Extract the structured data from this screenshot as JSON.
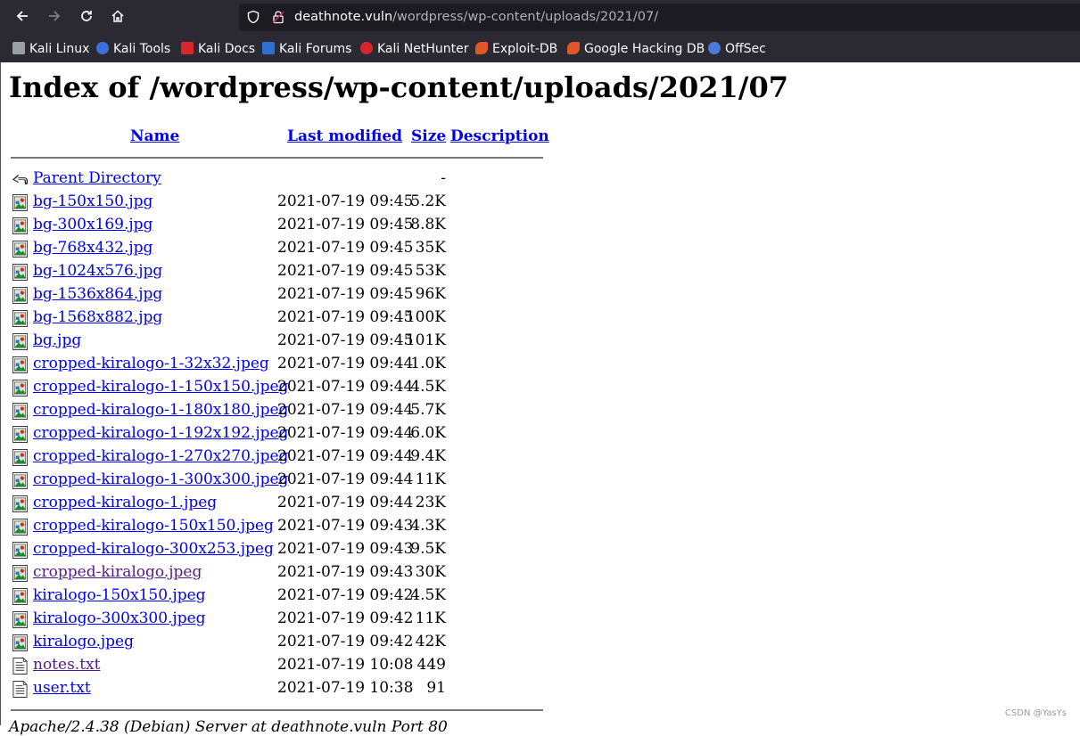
{
  "browser": {
    "url_host": "deathnote.vuln",
    "url_path": "/wordpress/wp-content/uploads/2021/07/",
    "bookmarks": [
      {
        "label": "Kali Linux",
        "icon": "kali-dragon-icon",
        "color": "#9aa0a6"
      },
      {
        "label": "Kali Tools",
        "icon": "kali-tools-icon",
        "color": "#3b6fe0"
      },
      {
        "label": "Kali Docs",
        "icon": "kali-docs-icon",
        "color": "#d8262c"
      },
      {
        "label": "Kali Forums",
        "icon": "kali-forums-icon",
        "color": "#2d6fd2"
      },
      {
        "label": "Kali NetHunter",
        "icon": "nethunter-icon",
        "color": "#d8262c"
      },
      {
        "label": "Exploit-DB",
        "icon": "exploit-db-icon",
        "color": "#e0582a"
      },
      {
        "label": "Google Hacking DB",
        "icon": "ghdb-icon",
        "color": "#e0582a"
      },
      {
        "label": "OffSec",
        "icon": "offsec-icon",
        "color": "#4a7bd6"
      }
    ]
  },
  "page": {
    "title": "Index of /wordpress/wp-content/uploads/2021/07",
    "columns": {
      "name": "Name",
      "last_modified": "Last modified",
      "size": "Size",
      "description": "Description"
    },
    "rows": [
      {
        "name": "Parent Directory",
        "date": "",
        "size": "-",
        "icon": "back-arrow-icon",
        "visited": false
      },
      {
        "name": "bg-150x150.jpg",
        "date": "2021-07-19 09:45",
        "size": "5.2K",
        "icon": "image-file-icon",
        "visited": false
      },
      {
        "name": "bg-300x169.jpg",
        "date": "2021-07-19 09:45",
        "size": "8.8K",
        "icon": "image-file-icon",
        "visited": false
      },
      {
        "name": "bg-768x432.jpg",
        "date": "2021-07-19 09:45",
        "size": "35K",
        "icon": "image-file-icon",
        "visited": false
      },
      {
        "name": "bg-1024x576.jpg",
        "date": "2021-07-19 09:45",
        "size": "53K",
        "icon": "image-file-icon",
        "visited": false
      },
      {
        "name": "bg-1536x864.jpg",
        "date": "2021-07-19 09:45",
        "size": "96K",
        "icon": "image-file-icon",
        "visited": false
      },
      {
        "name": "bg-1568x882.jpg",
        "date": "2021-07-19 09:45",
        "size": "100K",
        "icon": "image-file-icon",
        "visited": false
      },
      {
        "name": "bg.jpg",
        "date": "2021-07-19 09:45",
        "size": "101K",
        "icon": "image-file-icon",
        "visited": false
      },
      {
        "name": "cropped-kiralogo-1-32x32.jpeg",
        "date": "2021-07-19 09:44",
        "size": "1.0K",
        "icon": "image-file-icon",
        "visited": false
      },
      {
        "name": "cropped-kiralogo-1-150x150.jpeg",
        "date": "2021-07-19 09:44",
        "size": "4.5K",
        "icon": "image-file-icon",
        "visited": false
      },
      {
        "name": "cropped-kiralogo-1-180x180.jpeg",
        "date": "2021-07-19 09:44",
        "size": "5.7K",
        "icon": "image-file-icon",
        "visited": false
      },
      {
        "name": "cropped-kiralogo-1-192x192.jpeg",
        "date": "2021-07-19 09:44",
        "size": "6.0K",
        "icon": "image-file-icon",
        "visited": false
      },
      {
        "name": "cropped-kiralogo-1-270x270.jpeg",
        "date": "2021-07-19 09:44",
        "size": "9.4K",
        "icon": "image-file-icon",
        "visited": false
      },
      {
        "name": "cropped-kiralogo-1-300x300.jpeg",
        "date": "2021-07-19 09:44",
        "size": "11K",
        "icon": "image-file-icon",
        "visited": false
      },
      {
        "name": "cropped-kiralogo-1.jpeg",
        "date": "2021-07-19 09:44",
        "size": "23K",
        "icon": "image-file-icon",
        "visited": false
      },
      {
        "name": "cropped-kiralogo-150x150.jpeg",
        "date": "2021-07-19 09:43",
        "size": "4.3K",
        "icon": "image-file-icon",
        "visited": false
      },
      {
        "name": "cropped-kiralogo-300x253.jpeg",
        "date": "2021-07-19 09:43",
        "size": "9.5K",
        "icon": "image-file-icon",
        "visited": false
      },
      {
        "name": "cropped-kiralogo.jpeg",
        "date": "2021-07-19 09:43",
        "size": "30K",
        "icon": "image-file-icon",
        "visited": true
      },
      {
        "name": "kiralogo-150x150.jpeg",
        "date": "2021-07-19 09:42",
        "size": "4.5K",
        "icon": "image-file-icon",
        "visited": false
      },
      {
        "name": "kiralogo-300x300.jpeg",
        "date": "2021-07-19 09:42",
        "size": "11K",
        "icon": "image-file-icon",
        "visited": false
      },
      {
        "name": "kiralogo.jpeg",
        "date": "2021-07-19 09:42",
        "size": "42K",
        "icon": "image-file-icon",
        "visited": false
      },
      {
        "name": "notes.txt",
        "date": "2021-07-19 10:08",
        "size": "449",
        "icon": "text-file-icon",
        "visited": true
      },
      {
        "name": "user.txt",
        "date": "2021-07-19 10:38",
        "size": "91",
        "icon": "text-file-icon",
        "visited": false
      }
    ],
    "footer": "Apache/2.4.38 (Debian) Server at deathnote.vuln Port 80"
  },
  "watermark": "CSDN @YasYs"
}
